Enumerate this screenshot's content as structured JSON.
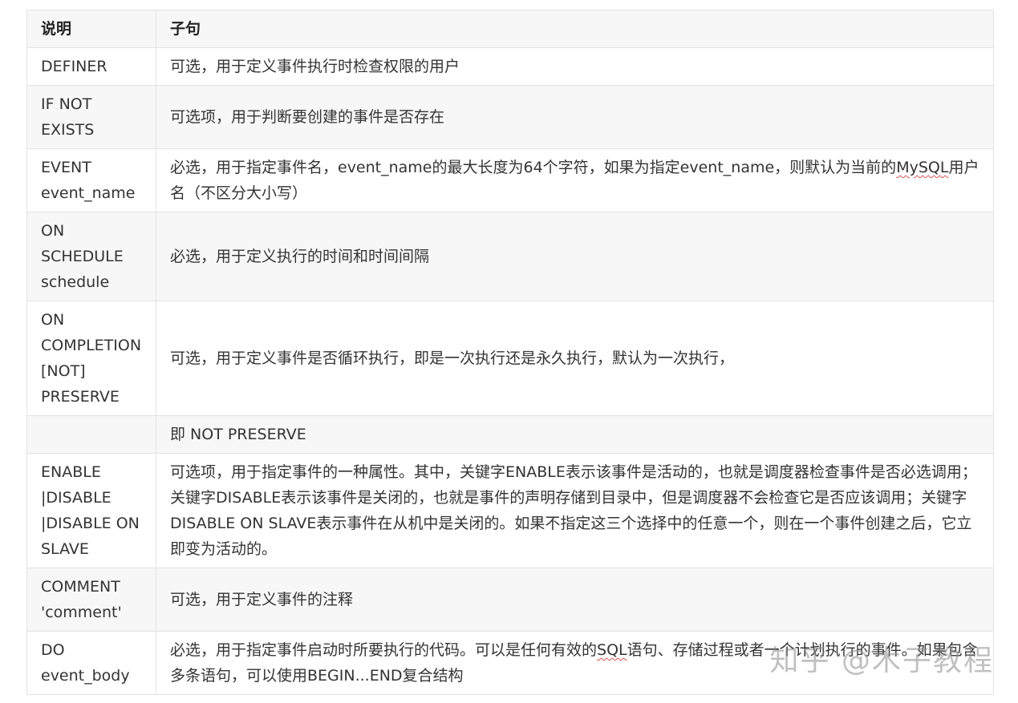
{
  "table": {
    "headers": [
      "说明",
      "子句"
    ],
    "rows": [
      {
        "term": "DEFINER",
        "desc": "可选，用于定义事件执行时检查权限的用户"
      },
      {
        "term": "IF NOT EXISTS",
        "desc": "可选项，用于判断要创建的事件是否存在"
      },
      {
        "term": "EVENT event_name",
        "desc_parts": [
          "必选，用于指定事件名，event_name的最大长度为64个字符，如果为指定event_name，则默认为当前的",
          "MySQL",
          "用户名（不区分大小写）"
        ]
      },
      {
        "term": "ON SCHEDULE schedule",
        "desc": "必选，用于定义执行的时间和时间间隔"
      },
      {
        "term": "ON COMPLETION [NOT] PRESERVE",
        "desc": "可选，用于定义事件是否循环执行，即是一次执行还是永久执行，默认为一次执行，"
      },
      {
        "term": "",
        "desc": "即 NOT PRESERVE"
      },
      {
        "term": "ENABLE |DISABLE |DISABLE ON SLAVE",
        "desc": "可选项，用于指定事件的一种属性。其中，关键字ENABLE表示该事件是活动的，也就是调度器检查事件是否必选调用；关键字DISABLE表示该事件是关闭的，也就是事件的声明存储到目录中，但是调度器不会检查它是否应该调用；关键字DISABLE ON SLAVE表示事件在从机中是关闭的。如果不指定这三个选择中的任意一个，则在一个事件创建之后，它立即变为活动的。"
      },
      {
        "term": "COMMENT 'comment'",
        "desc": "可选，用于定义事件的注释"
      },
      {
        "term": "DO event_body",
        "desc_parts": [
          "必选，用于指定事件启动时所要执行的代码。可以是任何有效的",
          "SQL",
          "语句、存储过程或者一个计划执行的事件。如果包含多条语句，可以使用BEGIN...END复合结构"
        ]
      }
    ]
  },
  "watermark": "知乎 @木子教程"
}
